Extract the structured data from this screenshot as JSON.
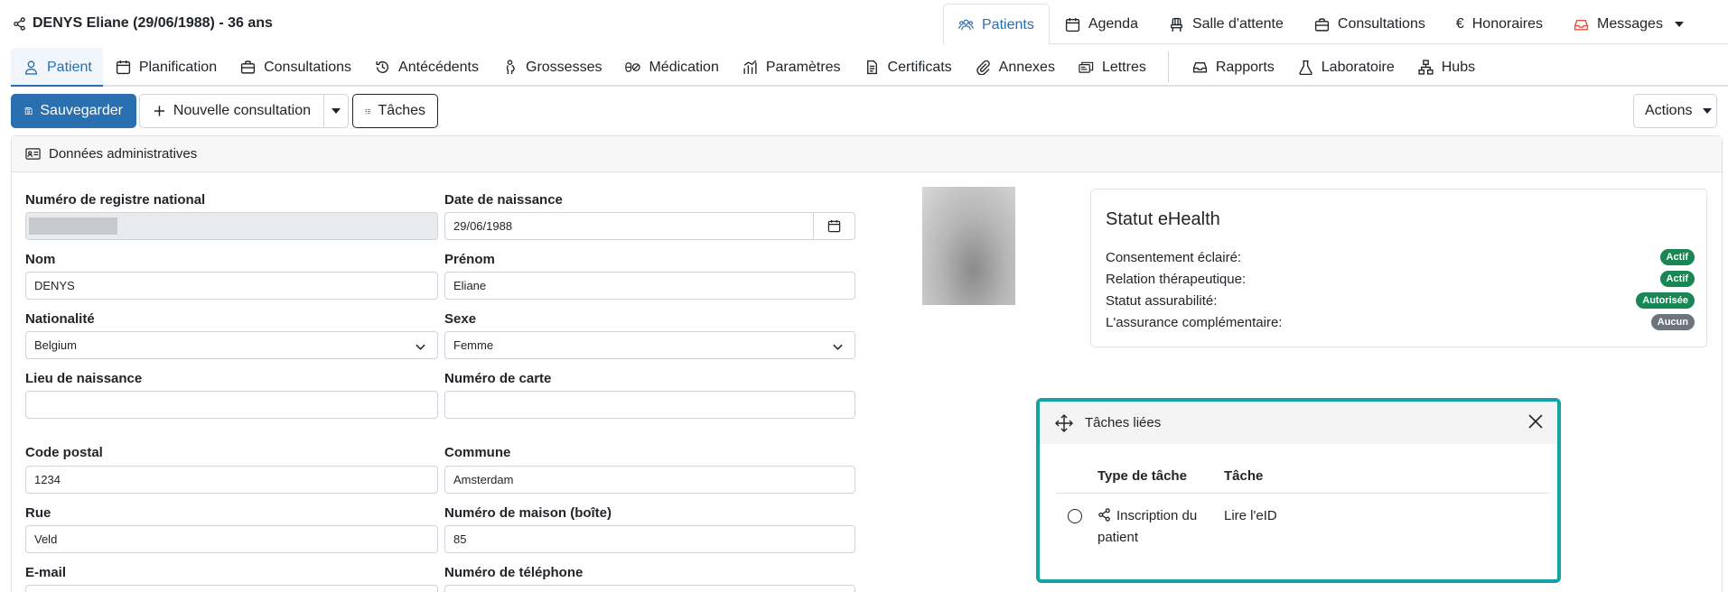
{
  "header": {
    "patient_title": "DENYS Eliane (29/06/1988) - 36 ans",
    "top_tabs": [
      {
        "label": "Patients",
        "icon": "users-icon",
        "active": true
      },
      {
        "label": "Agenda",
        "icon": "calendar-icon"
      },
      {
        "label": "Salle d'attente",
        "icon": "chair-icon"
      },
      {
        "label": "Consultations",
        "icon": "briefcase-icon"
      },
      {
        "label": "Honoraires",
        "icon": "euro-icon"
      },
      {
        "label": "Messages",
        "icon": "inbox-icon"
      }
    ]
  },
  "subnav": {
    "tabs": [
      {
        "label": "Patient",
        "icon": "user-icon",
        "active": true
      },
      {
        "label": "Planification",
        "icon": "calendar-icon"
      },
      {
        "label": "Consultations",
        "icon": "briefcase-icon"
      },
      {
        "label": "Antécédents",
        "icon": "history-icon"
      },
      {
        "label": "Grossesses",
        "icon": "pregnancy-icon"
      },
      {
        "label": "Médication",
        "icon": "pills-icon"
      },
      {
        "label": "Paramètres",
        "icon": "chart-bars-icon"
      },
      {
        "label": "Certificats",
        "icon": "document-icon"
      },
      {
        "label": "Annexes",
        "icon": "paperclip-icon"
      },
      {
        "label": "Lettres",
        "icon": "letters-icon"
      },
      {
        "label": "Rapports",
        "icon": "inbox-icon"
      },
      {
        "label": "Laboratoire",
        "icon": "flask-icon"
      },
      {
        "label": "Hubs",
        "icon": "sitemap-icon"
      }
    ]
  },
  "toolbar": {
    "save_label": "Sauvegarder",
    "new_consultation_label": "Nouvelle consultation",
    "tasks_label": "Tâches",
    "actions_label": "Actions"
  },
  "card": {
    "title": "Données administratives"
  },
  "form": {
    "registre_label": "Numéro de registre national",
    "naissance_label": "Date de naissance",
    "naissance_value": "29/06/1988",
    "nom_label": "Nom",
    "nom_value": "DENYS",
    "prenom_label": "Prénom",
    "prenom_value": "Eliane",
    "nationalite_label": "Nationalité",
    "nationalite_value": "Belgium",
    "sexe_label": "Sexe",
    "sexe_value": "Femme",
    "lieu_label": "Lieu de naissance",
    "lieu_value": "",
    "carte_label": "Numéro de carte",
    "carte_value": "",
    "cp_label": "Code postal",
    "cp_value": "1234",
    "commune_label": "Commune",
    "commune_value": "Amsterdam",
    "rue_label": "Rue",
    "rue_value": "Veld",
    "maison_label": "Numéro de maison (boîte)",
    "maison_value": "85",
    "email_label": "E-mail",
    "tel_label": "Numéro de téléphone"
  },
  "ehealth": {
    "title": "Statut eHealth",
    "rows": [
      {
        "label": "Consentement éclairé:",
        "status": "Actif",
        "color": "#198754"
      },
      {
        "label": "Relation thérapeutique:",
        "status": "Actif",
        "color": "#198754"
      },
      {
        "label": "Statut assurabilité:",
        "status": "Autorisée",
        "color": "#198754"
      },
      {
        "label": "L'assurance complémentaire:",
        "status": "Aucun",
        "color": "#6c757d"
      }
    ]
  },
  "tasks_panel": {
    "title": "Tâches liées",
    "col_type": "Type de tâche",
    "col_task": "Tâche",
    "rows": [
      {
        "type": "Inscription du patient",
        "task": "Lire l'eID"
      }
    ]
  },
  "colors": {
    "primary": "#2a6fb0",
    "panel_border": "#17a2a2",
    "badge_green": "#198754",
    "badge_grey": "#6c757d"
  }
}
